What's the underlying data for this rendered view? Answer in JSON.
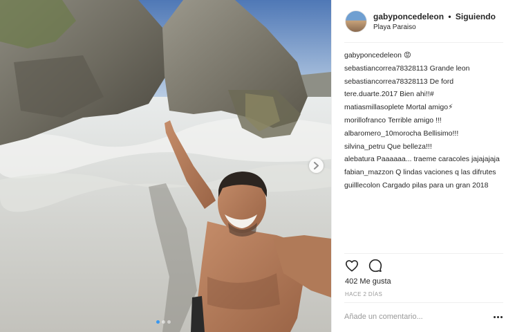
{
  "post": {
    "image_alt": "Foto",
    "carousel": {
      "count": 3,
      "active": 0
    }
  },
  "header": {
    "username": "gabyponcedeleon",
    "separator": "•",
    "follow_status": "Siguiendo",
    "location": "Playa Paraiso"
  },
  "comments": [
    {
      "user": "gabyponcedeleon",
      "text": "😡"
    },
    {
      "user": "sebastiancorrea78328113",
      "text": "Grande leon"
    },
    {
      "user": "sebastiancorrea78328113",
      "text": "De ford"
    },
    {
      "user": "tere.duarte.2017",
      "text": "Bien ahi!!#"
    },
    {
      "user": "matiasmillasoplete",
      "text": "Mortal amigo⚡"
    },
    {
      "user": "morillofranco",
      "text": "Terrible amigo !!!"
    },
    {
      "user": "albaromero_10morocha",
      "text": "Bellisimo!!!"
    },
    {
      "user": "silvina_petru",
      "text": "Que belleza!!!"
    },
    {
      "user": "alebatura",
      "text": "Paaaaaa... traeme caracoles jajajajaja"
    },
    {
      "user": "fabian_mazzon",
      "text": "Q lindas vaciones q las difrutes"
    },
    {
      "user": "guilllecolon",
      "text": "Cargado pilas para un gran 2018"
    }
  ],
  "actions": {
    "like_icon": "heart-icon",
    "comment_icon": "comment-bubble-icon",
    "likes_text": "402 Me gusta",
    "time_text": "HACE 2 DÍAS"
  },
  "comment_box": {
    "placeholder": "Añade un comentario...",
    "value": ""
  },
  "colors": {
    "accent": "#3897f0",
    "text": "#262626",
    "muted": "#999999",
    "divider": "#efefef"
  }
}
